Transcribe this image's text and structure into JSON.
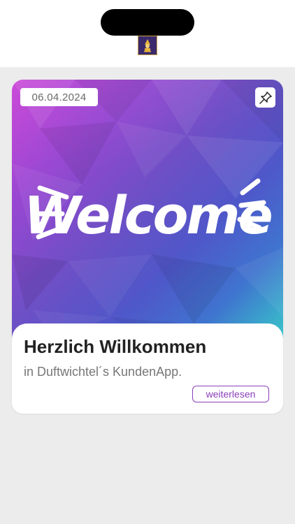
{
  "post": {
    "date": "06.04.2024",
    "image_text": "Welcome",
    "title": "Herzlich Willkommen",
    "subtitle": "in Duftwichtel´s KundenApp.",
    "read_more_label": "weiterlesen"
  },
  "icons": {
    "logo": "app-logo-icon",
    "pin": "pin-icon"
  },
  "colors": {
    "accent": "#8a3fb8",
    "background": "#ececec"
  }
}
